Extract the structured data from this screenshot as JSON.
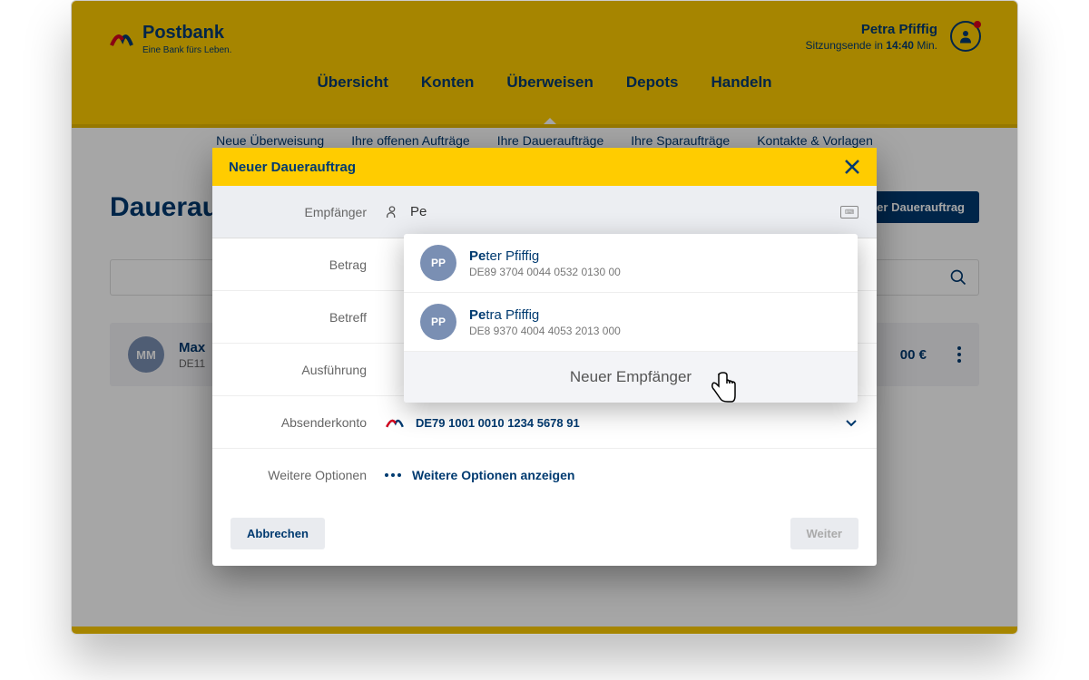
{
  "brand": {
    "name": "Postbank",
    "tagline": "Eine Bank fürs Leben."
  },
  "user": {
    "name": "Petra Pfiffig",
    "session_prefix": "Sitzungsende in ",
    "session_time": "14:40",
    "session_suffix": " Min."
  },
  "nav": {
    "items": [
      "Übersicht",
      "Konten",
      "Überweisen",
      "Depots",
      "Handeln"
    ],
    "active": 2
  },
  "subnav": {
    "items": [
      "Neue Überweisung",
      "Ihre offenen Aufträge",
      "Ihre Daueraufträge",
      "Ihre Sparaufträge",
      "Kontakte & Vorlagen"
    ]
  },
  "page": {
    "title": "Daueraufträge",
    "new_button": "+ Neuer Dauerauftrag"
  },
  "list_row": {
    "initials": "MM",
    "name": "Max",
    "iban": "DE11",
    "amount": "00 €"
  },
  "modal": {
    "title": "Neuer Dauerauftrag",
    "labels": {
      "recipient": "Empfänger",
      "amount": "Betrag",
      "subject": "Betreff",
      "execution": "Ausführung",
      "sender": "Absenderkonto",
      "more": "Weitere Optionen"
    },
    "recipient_input": "Pe",
    "sender_iban": "DE79 1001 0010 1234 5678 91",
    "more_link": "Weitere Optionen anzeigen",
    "cancel": "Abbrechen",
    "next": "Weiter"
  },
  "autocomplete": {
    "items": [
      {
        "initials": "PP",
        "match": "Pe",
        "rest": "ter Pfiffig",
        "iban": "DE89 3704 0044 0532 0130 00"
      },
      {
        "initials": "PP",
        "match": "Pe",
        "rest": "tra Pfiffig",
        "iban": "DE8 9370 4004 4053 2013 000"
      }
    ],
    "new_label": "Neuer Empfänger"
  }
}
